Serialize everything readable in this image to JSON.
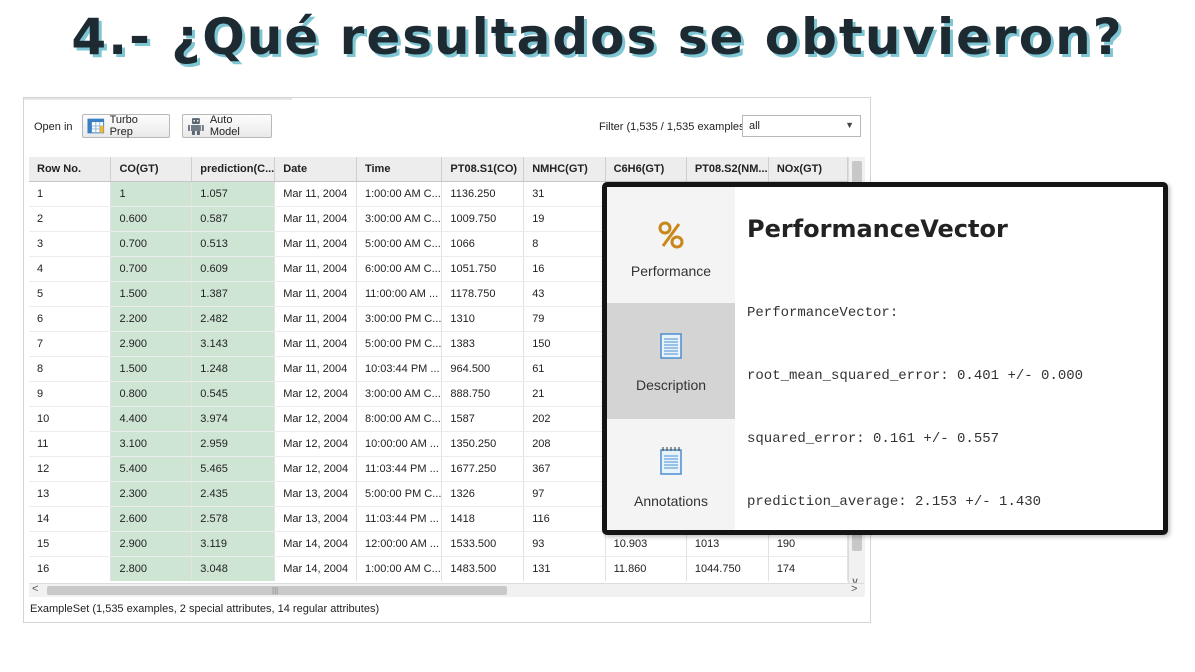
{
  "slide": {
    "title": "4.- ¿Qué resultados se obtuvieron?"
  },
  "toolbar": {
    "open_in_label": "Open in",
    "turbo_prep_label": "Turbo Prep",
    "auto_model_label": "Auto Model",
    "filter_label": "Filter (1,535 / 1,535 examples):",
    "filter_value": "all"
  },
  "table": {
    "columns": [
      "Row No.",
      "CO(GT)",
      "prediction(C...",
      "Date",
      "Time",
      "PT08.S1(CO)",
      "NMHC(GT)",
      "C6H6(GT)",
      "PT08.S2(NM...",
      "NOx(GT)"
    ],
    "rows": [
      [
        "1",
        "1",
        "1.057",
        "Mar 11, 2004",
        "1:00:00 AM C...",
        "1136.250",
        "31",
        "",
        "",
        ""
      ],
      [
        "2",
        "0.600",
        "0.587",
        "Mar 11, 2004",
        "3:00:00 AM C...",
        "1009.750",
        "19",
        "",
        "",
        ""
      ],
      [
        "3",
        "0.700",
        "0.513",
        "Mar 11, 2004",
        "5:00:00 AM C...",
        "1066",
        "8",
        "",
        "",
        ""
      ],
      [
        "4",
        "0.700",
        "0.609",
        "Mar 11, 2004",
        "6:00:00 AM C...",
        "1051.750",
        "16",
        "",
        "",
        ""
      ],
      [
        "5",
        "1.500",
        "1.387",
        "Mar 11, 2004",
        "11:00:00 AM ...",
        "1178.750",
        "43",
        "",
        "",
        ""
      ],
      [
        "6",
        "2.200",
        "2.482",
        "Mar 11, 2004",
        "3:00:00 PM C...",
        "1310",
        "79",
        "",
        "",
        ""
      ],
      [
        "7",
        "2.900",
        "3.143",
        "Mar 11, 2004",
        "5:00:00 PM C...",
        "1383",
        "150",
        "",
        "",
        ""
      ],
      [
        "8",
        "1.500",
        "1.248",
        "Mar 11, 2004",
        "10:03:44 PM ...",
        "964.500",
        "61",
        "",
        "",
        ""
      ],
      [
        "9",
        "0.800",
        "0.545",
        "Mar 12, 2004",
        "3:00:00 AM C...",
        "888.750",
        "21",
        "",
        "",
        ""
      ],
      [
        "10",
        "4.400",
        "3.974",
        "Mar 12, 2004",
        "8:00:00 AM C...",
        "1587",
        "202",
        "",
        "",
        ""
      ],
      [
        "11",
        "3.100",
        "2.959",
        "Mar 12, 2004",
        "10:00:00 AM ...",
        "1350.250",
        "208",
        "",
        "",
        ""
      ],
      [
        "12",
        "5.400",
        "5.465",
        "Mar 12, 2004",
        "11:03:44 PM ...",
        "1677.250",
        "367",
        "",
        "",
        ""
      ],
      [
        "13",
        "2.300",
        "2.435",
        "Mar 13, 2004",
        "5:00:00 PM C...",
        "1326",
        "97",
        "",
        "",
        ""
      ],
      [
        "14",
        "2.600",
        "2.578",
        "Mar 13, 2004",
        "11:03:44 PM ...",
        "1418",
        "116",
        "",
        "",
        ""
      ],
      [
        "15",
        "2.900",
        "3.119",
        "Mar 14, 2004",
        "12:00:00 AM ...",
        "1533.500",
        "93",
        "10.903",
        "1013",
        "190"
      ],
      [
        "16",
        "2.800",
        "3.048",
        "Mar 14, 2004",
        "1:00:00 AM C...",
        "1483.500",
        "131",
        "11.860",
        "1044.750",
        "174"
      ]
    ]
  },
  "status_text": "ExampleSet (1,535 examples, 2 special attributes, 14 regular attributes)",
  "performance_popup": {
    "tabs": [
      {
        "label": "Performance",
        "icon": "percent-icon"
      },
      {
        "label": "Description",
        "icon": "document-icon"
      },
      {
        "label": "Annotations",
        "icon": "notepad-icon"
      }
    ],
    "heading": "PerformanceVector",
    "lines": [
      "PerformanceVector:",
      "root_mean_squared_error: 0.401 +/- 0.000",
      "squared_error: 0.161 +/- 0.557",
      "prediction_average: 2.153 +/- 1.430"
    ]
  },
  "colors": {
    "highlight_column": "#cfe5d4",
    "title_shadow": "#7ec6d3",
    "popup_border": "#141414"
  }
}
